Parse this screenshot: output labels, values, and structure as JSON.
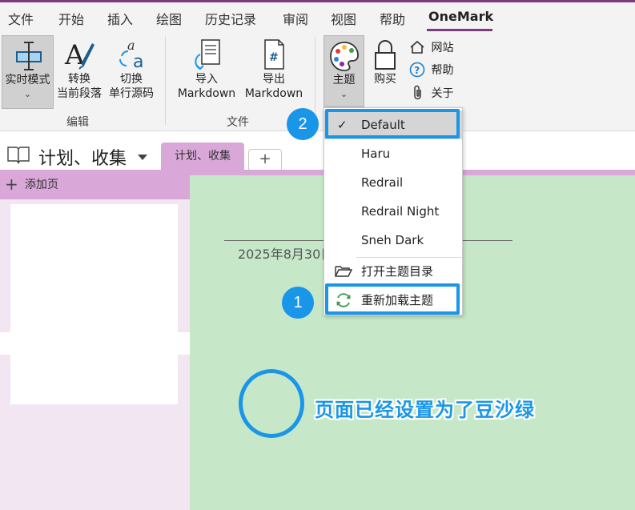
{
  "menu": {
    "tabs": [
      "文件",
      "开始",
      "插入",
      "绘图",
      "历史记录",
      "审阅",
      "视图",
      "帮助",
      "OneMark"
    ],
    "active": "OneMark"
  },
  "ribbon": {
    "edit": {
      "realtime_mode": "实时模式",
      "convert_line1": "转换",
      "convert_line2": "当前段落",
      "toggle_line1": "切换",
      "toggle_line2": "单行源码",
      "group_label": "编辑"
    },
    "file": {
      "import_line1": "导入",
      "import_line2": "Markdown",
      "export_line1": "导出",
      "export_line2": "Markdown",
      "group_label": "文件"
    },
    "misc": {
      "theme": "主题",
      "buy": "购买",
      "website": "网站",
      "help": "帮助",
      "about": "关于"
    }
  },
  "notebook": {
    "title": "计划、收集",
    "section_tab": "计划、收集",
    "add_tab": "+"
  },
  "pages": {
    "add_page": "添加页"
  },
  "page": {
    "date": "2025年8月30日"
  },
  "theme_menu": {
    "items": [
      "Default",
      "Haru",
      "Redrail",
      "Redrail Night",
      "Sneh Dark"
    ],
    "selected": "Default",
    "open_dir": "打开主题目录",
    "reload": "重新加载主题"
  },
  "annotations": {
    "badge1": "1",
    "badge2": "2",
    "callout": "页面已经设置为了豆沙绿"
  },
  "colors": {
    "accent": "#7b3b7c",
    "section": "#d9a7d8",
    "page_bg": "#c6e8c8",
    "annotation": "#1a96e8"
  }
}
